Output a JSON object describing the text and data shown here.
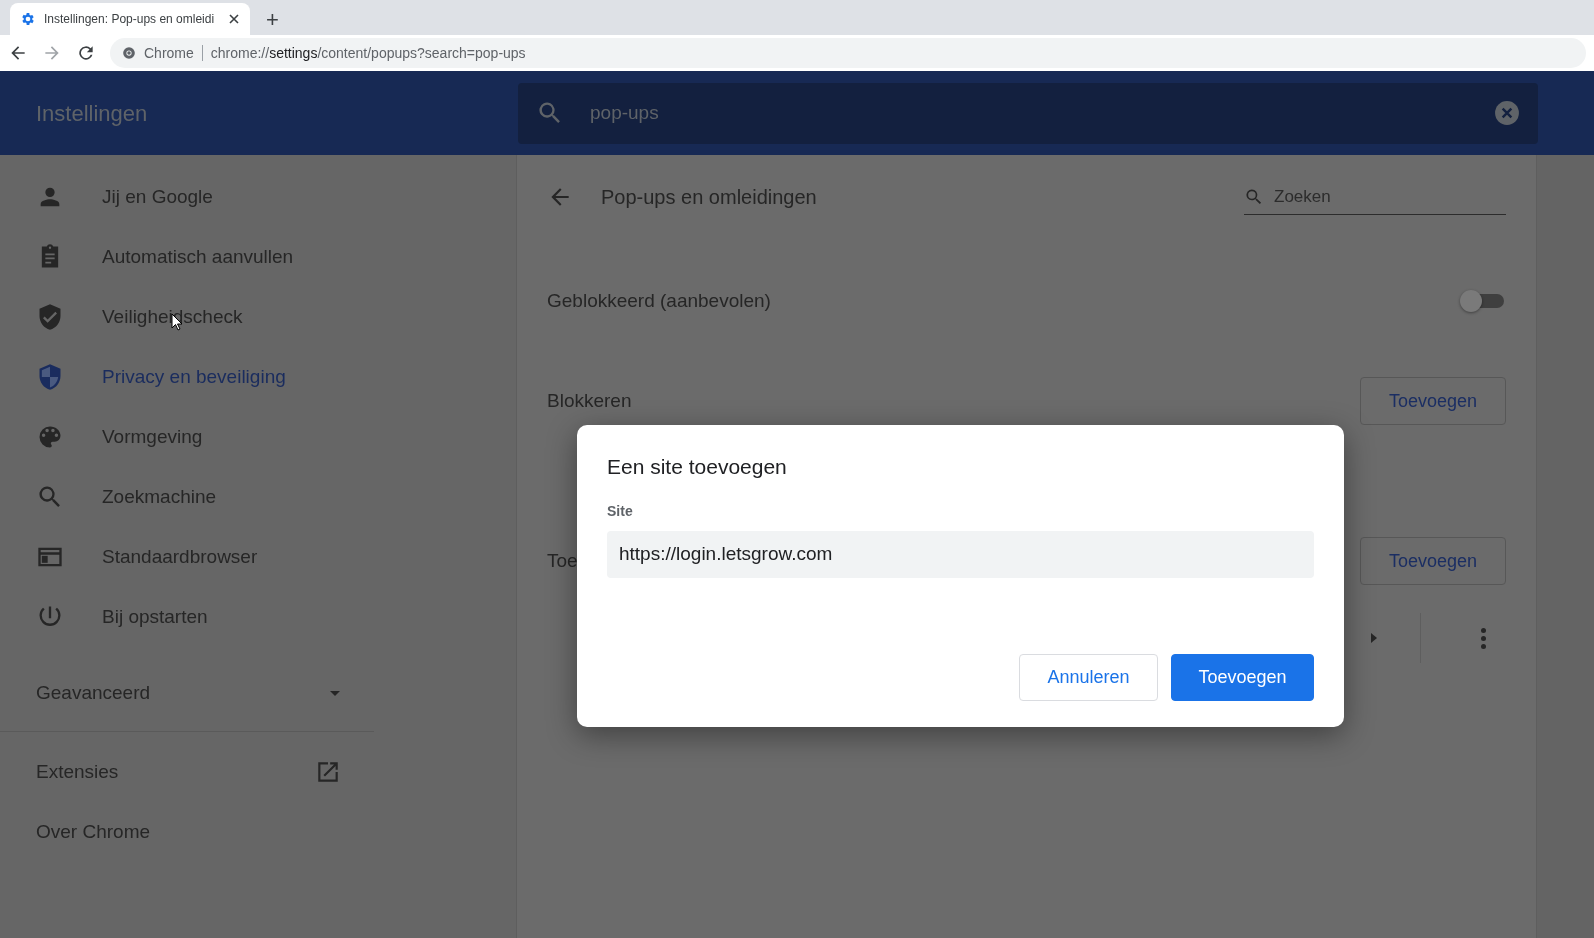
{
  "browser": {
    "tab": {
      "title": "Instellingen: Pop-ups en omleidi",
      "selected": true
    },
    "new_tab": "+",
    "site_label": "Chrome",
    "url": "chrome://**settings**/content/popups?search=pop-ups"
  },
  "header": {
    "title": "Instellingen",
    "search": {
      "value": "pop-ups"
    }
  },
  "sidebar": {
    "items": [
      {
        "label": "Jij en Google",
        "selected": false
      },
      {
        "label": "Automatisch aanvullen",
        "selected": false
      },
      {
        "label": "Veiligheidscheck",
        "selected": false
      },
      {
        "label": "Privacy en beveiliging",
        "selected": true
      },
      {
        "label": "Vormgeving",
        "selected": false
      },
      {
        "label": "Zoekmachine",
        "selected": false
      },
      {
        "label": "Standaardbrowser",
        "selected": false
      },
      {
        "label": "Bij opstarten",
        "selected": false
      }
    ],
    "advanced": {
      "label": "Geavanceerd",
      "expanded": false
    },
    "links": [
      {
        "label": "Extensies",
        "external": true
      },
      {
        "label": "Over Chrome",
        "external": false
      }
    ]
  },
  "main": {
    "title": "Pop-ups en omleidingen",
    "search": {
      "placeholder": "Zoeken"
    },
    "blocked": {
      "label": "Geblokkeerd (aanbevolen)",
      "on": false
    },
    "sections": [
      {
        "title": "Blokkeren",
        "button": "Toevoegen"
      },
      {
        "title": "Toe",
        "button": "Toevoegen"
      }
    ]
  },
  "dialog": {
    "title": "Een site toevoegen",
    "field_label": "Site",
    "value": "https://login.letsgrow.com",
    "buttons": [
      {
        "label": "Annuleren",
        "kind": "secondary"
      },
      {
        "label": "Toevoegen",
        "kind": "primary"
      }
    ]
  }
}
